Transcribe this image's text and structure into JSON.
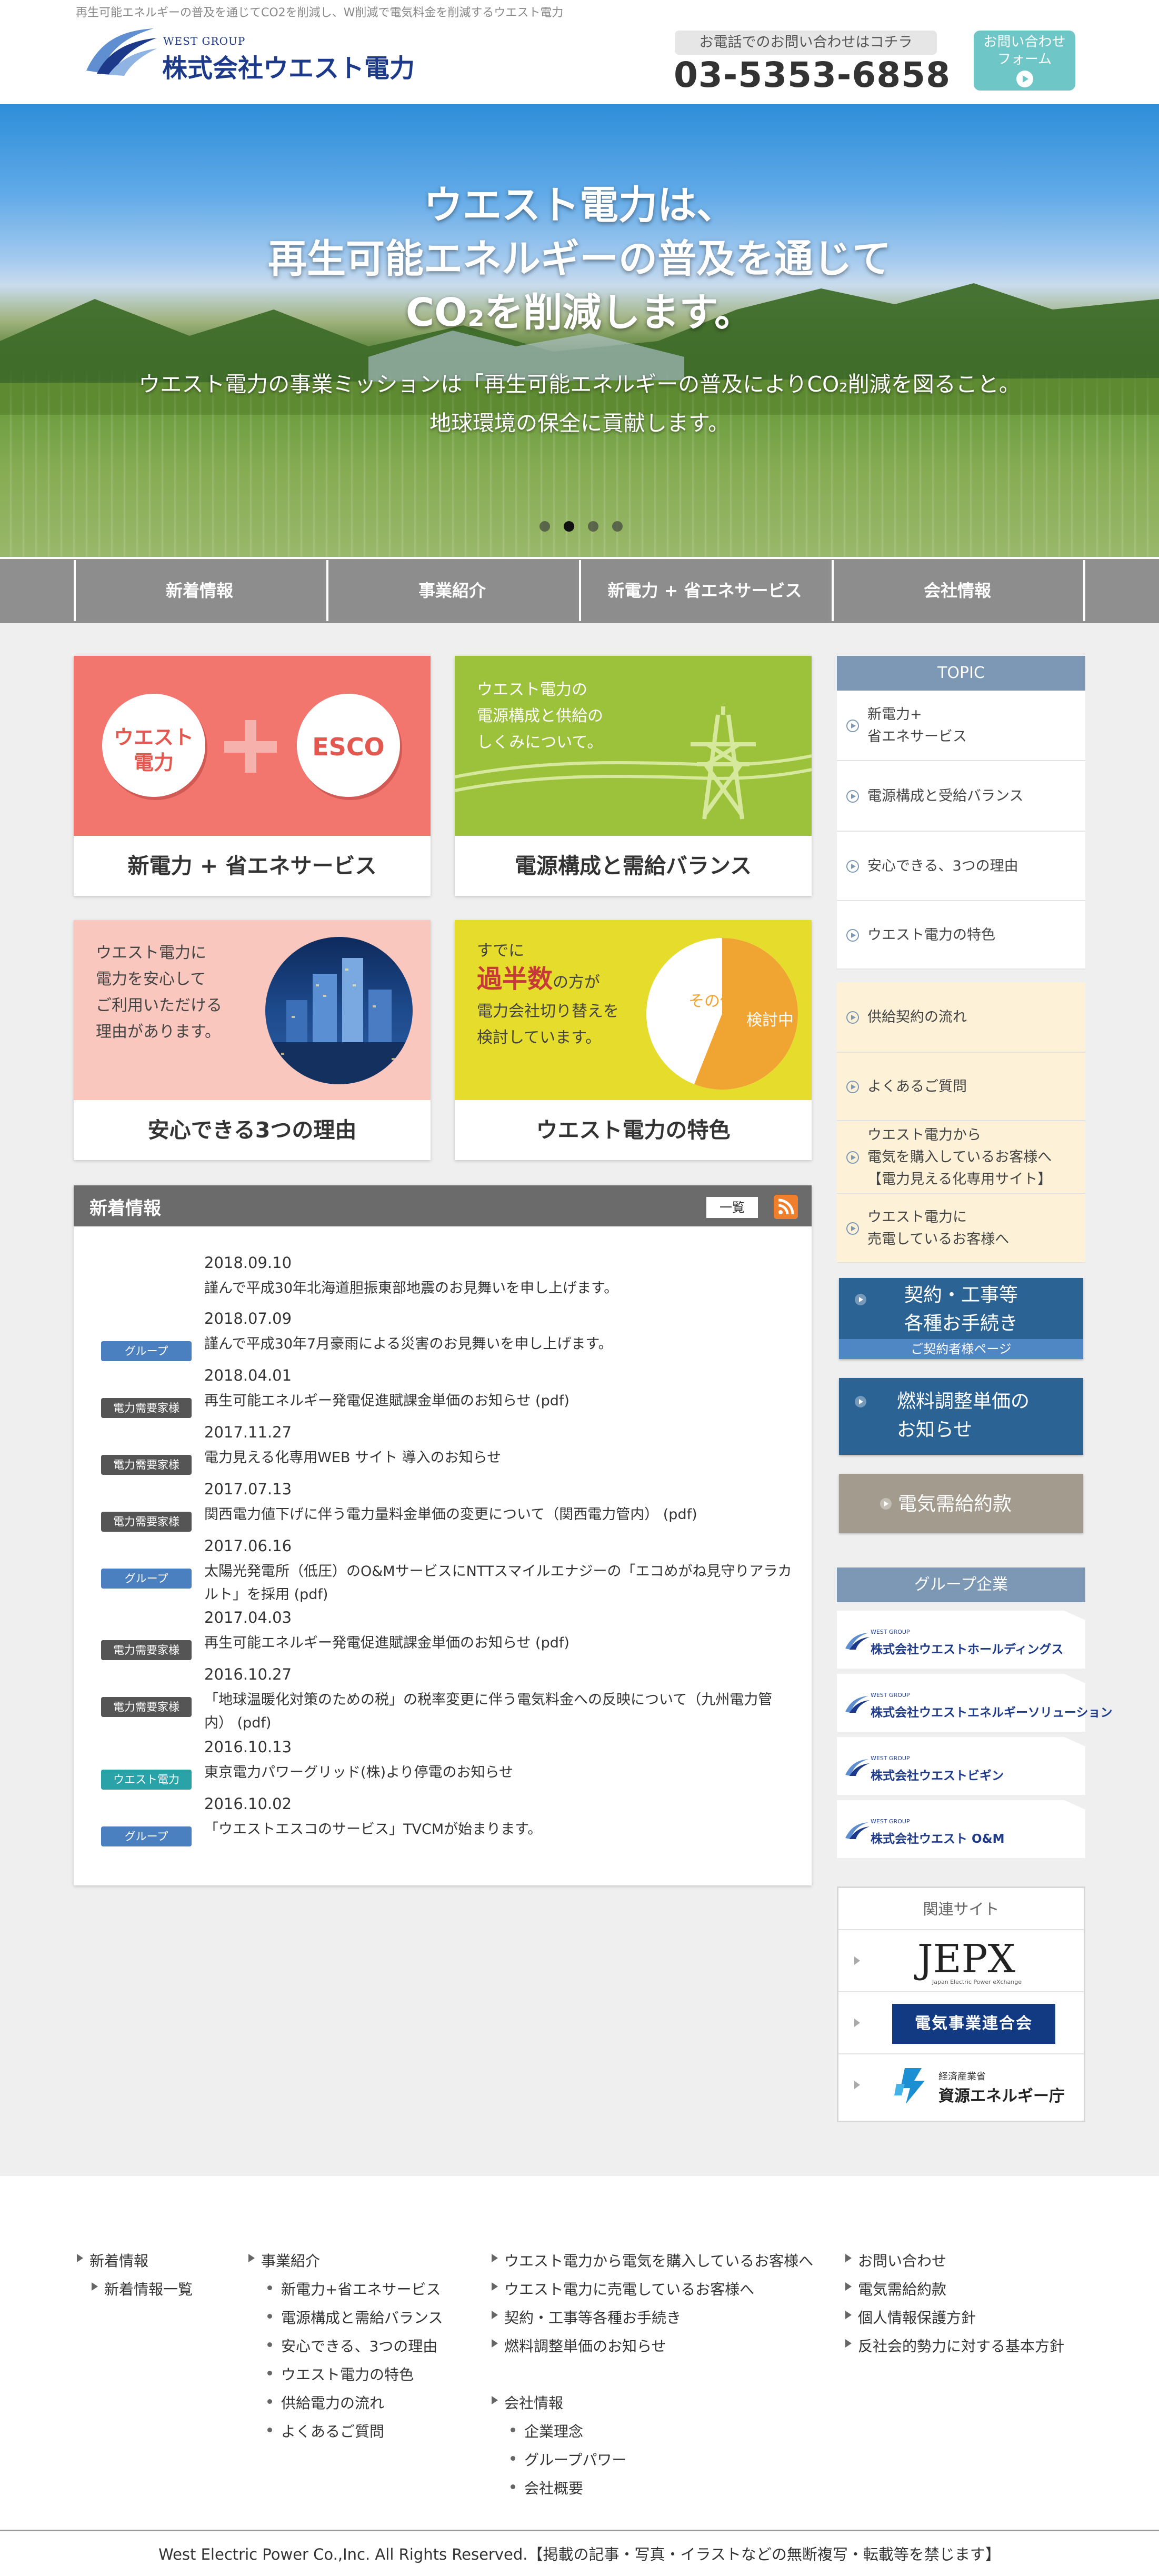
{
  "header": {
    "tagline": "再生可能エネルギーの普及を通じてCO2を削減し、W削減で電気料金を削減するウエスト電力",
    "logo_group": "WEST GROUP",
    "logo_company": "株式会社ウエスト電力",
    "phone_label": "お電話でのお問い合わせはコチラ",
    "phone_number": "03-5353-6858",
    "contact_line1": "お問い合わせ",
    "contact_line2": "フォーム"
  },
  "hero": {
    "line1": "ウエスト電力は、",
    "line2": "再生可能エネルギーの普及を通じて",
    "line3": "CO₂を削減します。",
    "sub1": "ウエスト電力の事業ミッションは「再生可能エネルギーの普及によりCO₂削減を図ること。",
    "sub2": "地球環境の保全に貢献します。",
    "slides": 4,
    "active_slide": 2
  },
  "nav": {
    "items": [
      "新着情報",
      "事業紹介",
      "新電力 + 省エネサービス",
      "会社情報"
    ]
  },
  "cards": [
    {
      "title": "新電力 + 省エネサービス",
      "badge1": "ウエスト\n電力",
      "badge1_l1": "ウエスト",
      "badge1_l2": "電力",
      "badge2": "ESCO"
    },
    {
      "title": "電源構成と需給バランス",
      "caption1": "ウエスト電力の",
      "caption2": "電源構成と供給の",
      "caption3": "しくみについて。"
    },
    {
      "title": "安心できる3つの理由",
      "caption1": "ウエスト電力に",
      "caption2": "電力を安心して",
      "caption3": "ご利用いただける",
      "caption4": "理由があります。"
    },
    {
      "title": "ウエスト電力の特色",
      "caption1": "すでに",
      "caption2a": "過半数",
      "caption2b": "の方が",
      "caption3": "電力会社切り替えを",
      "caption4": "検討しています。",
      "pie_other": "その他",
      "pie_main": "検討中",
      "pie_main_share": 0.56
    }
  ],
  "news": {
    "title": "新着情報",
    "list_button": "一覧",
    "items": [
      {
        "tag": "",
        "date": "2018.09.10",
        "text": "謹んで平成30年北海道胆振東部地震のお見舞いを申し上げます。"
      },
      {
        "tag": "グループ",
        "tag_color": "#4a7fc0",
        "date": "2018.07.09",
        "text": "謹んで平成30年7月豪雨による災害のお見舞いを申し上げます。"
      },
      {
        "tag": "電力需要家様",
        "tag_color": "#555555",
        "date": "2018.04.01",
        "text": "再生可能エネルギー発電促進賦課金単価のお知らせ (pdf)"
      },
      {
        "tag": "電力需要家様",
        "tag_color": "#555555",
        "date": "2017.11.27",
        "text": "電力見える化専用WEB サイト 導入のお知らせ"
      },
      {
        "tag": "電力需要家様",
        "tag_color": "#555555",
        "date": "2017.07.13",
        "text": "関西電力値下げに伴う電力量料金単価の変更について（関西電力管内） (pdf)"
      },
      {
        "tag": "グループ",
        "tag_color": "#4a7fc0",
        "date": "2017.06.16",
        "text": "太陽光発電所（低圧）のO&MサービスにNTTスマイルエナジーの「エコめがね見守りアラカルト」を採用 (pdf)"
      },
      {
        "tag": "電力需要家様",
        "tag_color": "#555555",
        "date": "2017.04.03",
        "text": "再生可能エネルギー発電促進賦課金単価のお知らせ (pdf)"
      },
      {
        "tag": "電力需要家様",
        "tag_color": "#555555",
        "date": "2016.10.27",
        "text": "「地球温暖化対策のための税」の税率変更に伴う電気料金への反映について（九州電力管内） (pdf)"
      },
      {
        "tag": "ウエスト電力",
        "tag_color": "#2aa3a8",
        "date": "2016.10.13",
        "text": "東京電力パワーグリッド(株)より停電のお知らせ"
      },
      {
        "tag": "グループ",
        "tag_color": "#4a7fc0",
        "date": "2016.10.02",
        "text": "「ウエストエスコのサービス」TVCMが始まります。"
      }
    ]
  },
  "sidebar": {
    "topic_title": "TOPIC",
    "topics": [
      {
        "label": "新電力+\n省エネサービス",
        "l1": "新電力+",
        "l2": "省エネサービス"
      },
      {
        "label": "電源構成と受給バランス",
        "l1": "電源構成と受給バランス"
      },
      {
        "label": "安心できる、3つの理由",
        "l1": "安心できる、3つの理由"
      },
      {
        "label": "ウエスト電力の特色",
        "l1": "ウエスト電力の特色"
      },
      {
        "label": "供給契約の流れ",
        "l1": "供給契約の流れ"
      },
      {
        "label": "よくあるご質問",
        "l1": "よくあるご質問"
      },
      {
        "label": "ウエスト電力から電気を購入しているお客様へ【電力見える化専用サイト】",
        "l1": "ウエスト電力から",
        "l2": "電気を購入しているお客様へ",
        "l3": "【電力見える化専用サイト】"
      },
      {
        "label": "ウエスト電力に売電しているお客様へ",
        "l1": "ウエスト電力に",
        "l2": "売電しているお客様へ"
      }
    ],
    "contract_btn_l1": "契約・工事等",
    "contract_btn_l2": "各種お手続き",
    "contract_btn_sub": "ご契約者様ページ",
    "fuel_btn_l1": "燃料調整単価の",
    "fuel_btn_l2": "お知らせ",
    "terms_btn": "電気需給約款",
    "group_title": "グループ企業",
    "group_small": "WEST GROUP",
    "group_items": [
      "株式会社ウエストホールディングス",
      "株式会社ウエストエネルギーソリューション",
      "株式会社ウエストビギン",
      "株式会社ウエスト O&M"
    ],
    "related_title": "関連サイト",
    "jepx_logo": "JEPX",
    "jepx_sub": "Japan Electric Power eXchange",
    "fepc_logo": "電気事業連合会",
    "enecho_small": "経済産業省",
    "enecho_logo": "資源エネルギー庁"
  },
  "footer": {
    "col1": [
      "新着情報",
      "新着情報一覧"
    ],
    "col2_head": "事業紹介",
    "col2": [
      "新電力+省エネサービス",
      "電源構成と需給バランス",
      "安心できる、3つの理由",
      "ウエスト電力の特色",
      "供給電力の流れ",
      "よくあるご質問"
    ],
    "col3": [
      "ウエスト電力から電気を購入しているお客様へ",
      "ウエスト電力に売電しているお客様へ",
      "契約・工事等各種お手続き",
      "燃料調整単価のお知らせ"
    ],
    "col3_head2": "会社情報",
    "col3_sub": [
      "企業理念",
      "グループパワー",
      "会社概要"
    ],
    "col4": [
      "お問い合わせ",
      "電気需給約款",
      "個人情報保護方針",
      "反社会的勢力に対する基本方針"
    ],
    "copyright": "West Electric Power Co.,Inc. All Rights Reserved.【掲載の記事・写真・イラストなどの無断複写・転載等を禁じます】"
  },
  "colors": {
    "nav_bg": "#8d8d8d",
    "topic_head": "#7c98b4",
    "button_blue": "#2a6394",
    "button_gray": "#a39c8e",
    "contact_btn": "#6fc6c7",
    "card1_bg": "#f2756e",
    "card2_bg": "#9cc23c",
    "card3_bg": "#f9c7bd",
    "card4_bg": "#e6dc2c",
    "pie_main": "#f0a532"
  }
}
